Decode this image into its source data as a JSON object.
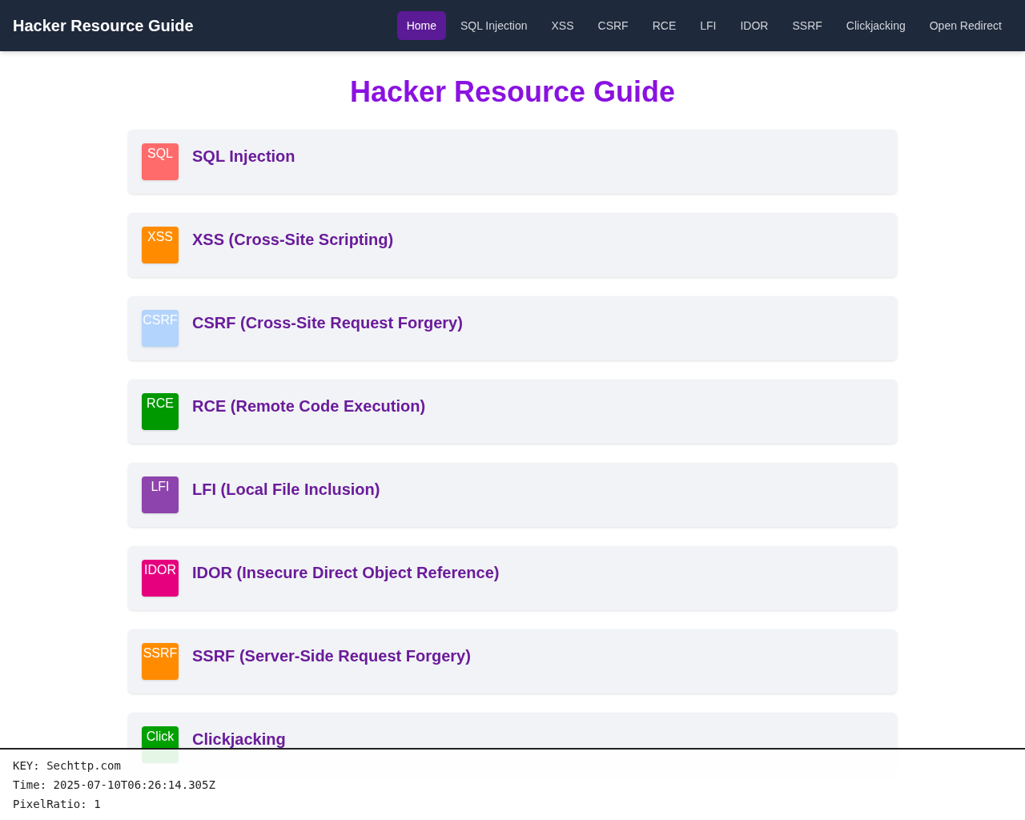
{
  "navbar": {
    "brand": "Hacker Resource Guide",
    "links": [
      {
        "label": "Home",
        "selected": true
      },
      {
        "label": "SQL Injection",
        "selected": false
      },
      {
        "label": "XSS",
        "selected": false
      },
      {
        "label": "CSRF",
        "selected": false
      },
      {
        "label": "RCE",
        "selected": false
      },
      {
        "label": "LFI",
        "selected": false
      },
      {
        "label": "IDOR",
        "selected": false
      },
      {
        "label": "SSRF",
        "selected": false
      },
      {
        "label": "Clickjacking",
        "selected": false
      },
      {
        "label": "Open Redirect",
        "selected": false
      }
    ]
  },
  "heading": "Hacker Resource Guide",
  "cards": [
    {
      "icon_text": "SQL",
      "color": "#ff6b6b",
      "title": "SQL Injection"
    },
    {
      "icon_text": "XSS",
      "color": "#ff8c00",
      "title": "XSS (Cross-Site Scripting)"
    },
    {
      "icon_text": "CSRF",
      "color": "#b3d4fc",
      "title": "CSRF (Cross-Site Request Forgery)"
    },
    {
      "icon_text": "RCE",
      "color": "#009900",
      "title": "RCE (Remote Code Execution)"
    },
    {
      "icon_text": "LFI",
      "color": "#8e44ad",
      "title": "LFI (Local File Inclusion)"
    },
    {
      "icon_text": "IDOR",
      "color": "#e6007e",
      "title": "IDOR (Insecure Direct Object Reference)"
    },
    {
      "icon_text": "SSRF",
      "color": "#ff8c00",
      "title": "SSRF (Server-Side Request Forgery)"
    },
    {
      "icon_text": "Click",
      "color": "#00a000",
      "title": "Clickjacking"
    }
  ],
  "overlay": {
    "lines": [
      "KEY: Sechttp.com",
      "Time: 2025-07-10T06:26:14.305Z",
      "PixelRatio: 1"
    ]
  }
}
